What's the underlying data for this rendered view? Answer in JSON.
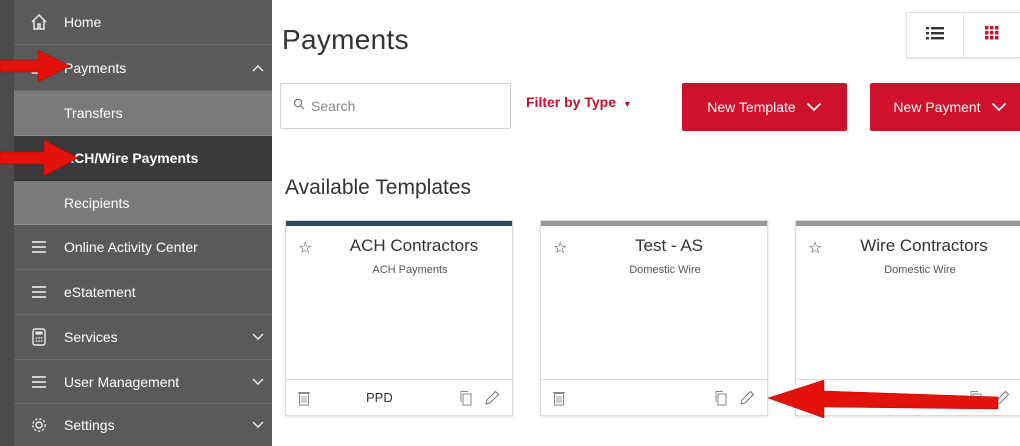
{
  "sidebar": {
    "items": [
      {
        "label": "Home",
        "icon": "home-icon"
      },
      {
        "label": "Payments",
        "icon": "payments-icon",
        "expanded": true
      },
      {
        "label": "Transfers",
        "sub": true
      },
      {
        "label": "ACH/Wire Payments",
        "sub": true,
        "active": true
      },
      {
        "label": "Recipients",
        "sub": true
      },
      {
        "label": "Online Activity Center",
        "icon": "menu-icon"
      },
      {
        "label": "eStatement",
        "icon": "menu-icon"
      },
      {
        "label": "Services",
        "icon": "calculator-icon",
        "chevron": "down"
      },
      {
        "label": "User Management",
        "icon": "menu-icon",
        "chevron": "down"
      },
      {
        "label": "Settings",
        "icon": "gear-icon",
        "chevron": "down"
      }
    ]
  },
  "main": {
    "title": "Payments",
    "search_placeholder": "Search",
    "filter_label": "Filter by Type",
    "new_template_label": "New Template",
    "new_payment_label": "New Payment",
    "section_title": "Available Templates",
    "templates": [
      {
        "name": "ACH Contractors",
        "type": "ACH Payments",
        "sec": "PPD"
      },
      {
        "name": "Test - AS",
        "type": "Domestic Wire",
        "sec": ""
      },
      {
        "name": "Wire Contractors",
        "type": "Domestic Wire",
        "sec": ""
      }
    ]
  },
  "colors": {
    "accent": "#d0112b",
    "sidebar": "#5a5a5a",
    "sidebar_active": "#3a3a3a",
    "sidebar_sub": "#7a7a7a",
    "annotation_arrow": "#e3120b"
  }
}
